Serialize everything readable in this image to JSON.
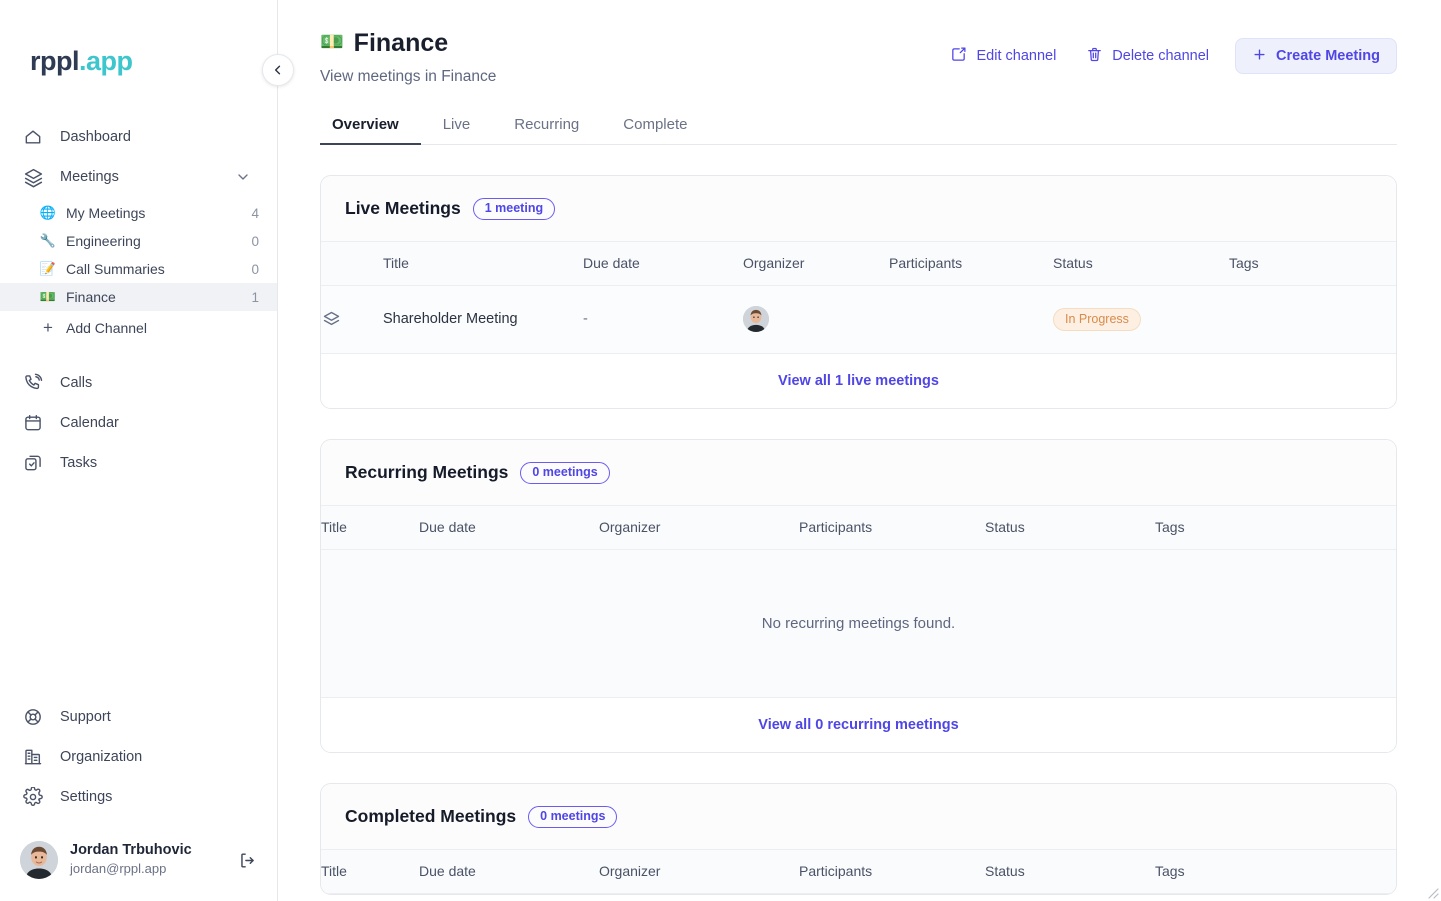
{
  "sidebar": {
    "logo": {
      "brand": "rppl",
      "tld": ".app"
    },
    "collapse_button": "collapse-sidebar",
    "nav": [
      {
        "label": "Dashboard",
        "icon": "home-icon"
      },
      {
        "label": "Meetings",
        "icon": "layers-icon",
        "expanded": true,
        "chevron": "chevron-down-icon"
      }
    ],
    "channels": [
      {
        "emoji": "🌐",
        "label": "My Meetings",
        "count": "4",
        "active": false
      },
      {
        "emoji": "🔧",
        "label": "Engineering",
        "count": "0",
        "active": false
      },
      {
        "emoji": "📝",
        "label": "Call Summaries",
        "count": "0",
        "active": false
      },
      {
        "emoji": "💵",
        "label": "Finance",
        "count": "1",
        "active": true
      }
    ],
    "add_channel": "Add Channel",
    "nav_mid": [
      {
        "label": "Calls",
        "icon": "phone-icon"
      },
      {
        "label": "Calendar",
        "icon": "calendar-icon"
      },
      {
        "label": "Tasks",
        "icon": "tasks-icon"
      }
    ],
    "nav_bottom": [
      {
        "label": "Support",
        "icon": "lifebuoy-icon"
      },
      {
        "label": "Organization",
        "icon": "building-icon"
      },
      {
        "label": "Settings",
        "icon": "gear-icon"
      }
    ],
    "profile": {
      "name": "Jordan Trbuhovic",
      "email": "jordan@rppl.app",
      "logout_icon": "logout-icon"
    }
  },
  "header": {
    "emoji": "💵",
    "title": "Finance",
    "subtitle": "View meetings in Finance",
    "actions": {
      "edit": "Edit channel",
      "delete": "Delete channel",
      "create": "Create Meeting"
    }
  },
  "tabs": [
    {
      "label": "Overview",
      "active": true
    },
    {
      "label": "Live",
      "active": false
    },
    {
      "label": "Recurring",
      "active": false
    },
    {
      "label": "Complete",
      "active": false
    }
  ],
  "sections": {
    "live": {
      "title": "Live Meetings",
      "pill": "1 meeting",
      "columns": [
        "",
        "Title",
        "Due date",
        "Organizer",
        "Participants",
        "Status",
        "Tags"
      ],
      "rows": [
        {
          "icon": "layers-icon",
          "title": "Shareholder Meeting",
          "due_date": "-",
          "organizer": "avatar",
          "participants": "",
          "status": "In Progress",
          "tags": ""
        }
      ],
      "view_all": "View all 1 live meetings"
    },
    "recurring": {
      "title": "Recurring Meetings",
      "pill": "0 meetings",
      "columns": [
        "Title",
        "Due date",
        "Organizer",
        "Participants",
        "Status",
        "Tags"
      ],
      "empty": "No recurring meetings found.",
      "view_all": "View all 0 recurring meetings"
    },
    "completed": {
      "title": "Completed Meetings",
      "pill": "0 meetings",
      "columns": [
        "Title",
        "Due date",
        "Organizer",
        "Participants",
        "Status",
        "Tags"
      ]
    }
  },
  "colors": {
    "accent": "#4f46e5",
    "brand_dark": "#2f3b52",
    "brand_teal": "#3ec6cd",
    "status_in_progress": "#d98b4a"
  }
}
